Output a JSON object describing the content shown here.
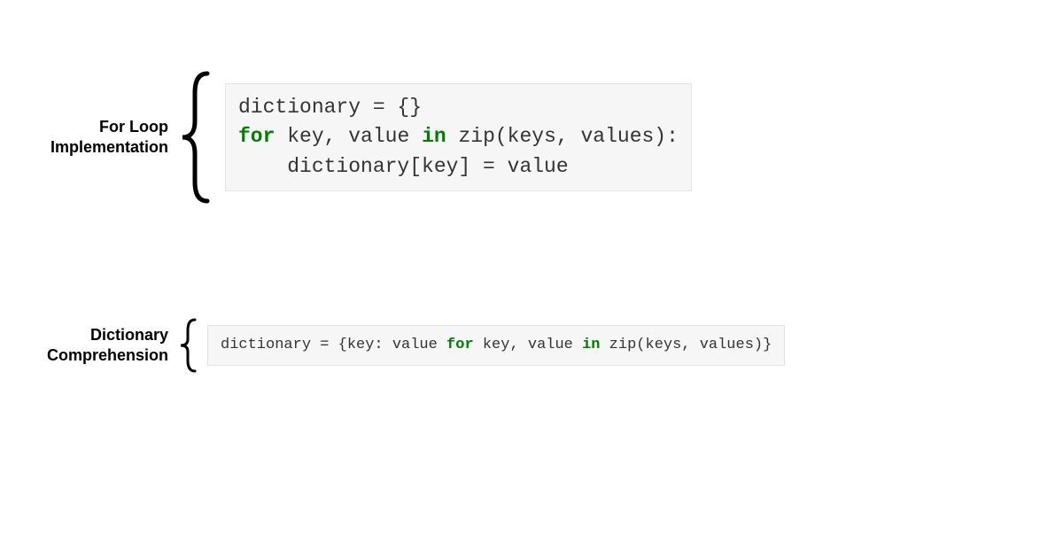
{
  "section1": {
    "label": "For Loop\nImplementation",
    "code": {
      "line1_a": "dictionary = {}",
      "line2_kw1": "for",
      "line2_mid": " key, value ",
      "line2_kw2": "in",
      "line2_end": " zip(keys, values):",
      "line3": "    dictionary[key] = value"
    }
  },
  "section2": {
    "label": "Dictionary\nComprehension",
    "code": {
      "line1_a": "dictionary = {key: value ",
      "line1_kw1": "for",
      "line1_b": " key, value ",
      "line1_kw2": "in",
      "line1_c": " zip(keys, values)}"
    }
  }
}
